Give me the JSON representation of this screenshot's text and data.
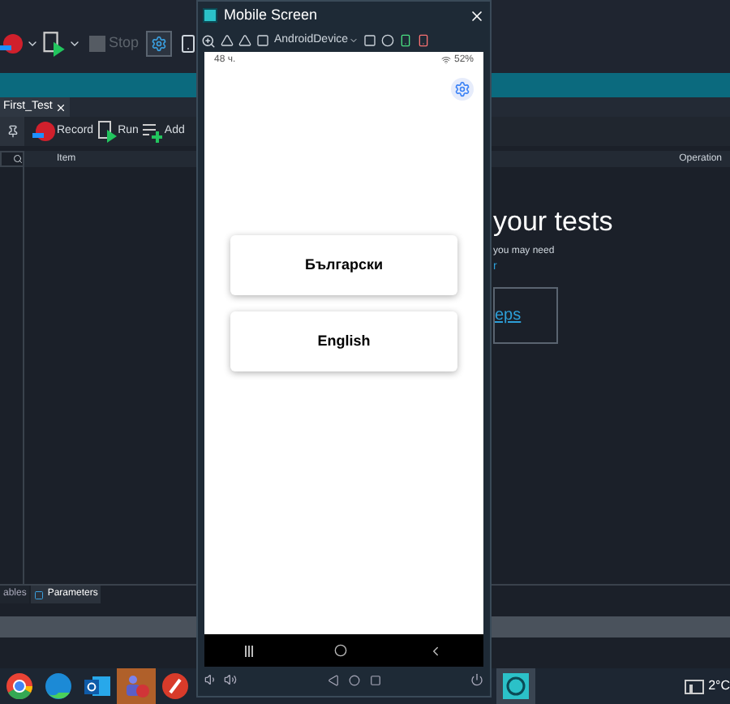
{
  "ide": {
    "toolbar": {
      "stop": {
        "label": "Stop",
        "disabled": true
      }
    },
    "tab": {
      "label": "First_Test",
      "selected": true
    },
    "actions": [
      {
        "kind": "record",
        "label": "Record"
      },
      {
        "kind": "run",
        "label": "Run"
      },
      {
        "kind": "add",
        "label": "Add"
      }
    ],
    "columns": [
      "Item",
      "Operation"
    ],
    "welcome": {
      "heading": "your tests",
      "text": "you may need",
      "link": "r",
      "card_link": "eps"
    },
    "bottom_tabs": [
      {
        "label": "ables",
        "selected": false
      },
      {
        "label": "Parameters",
        "selected": true
      }
    ]
  },
  "mobile_window": {
    "title": "Mobile Screen",
    "device": "AndroidDevice",
    "status_time": "48 ч.",
    "battery": "52%",
    "language_buttons": [
      "Български",
      "English"
    ]
  },
  "taskbar": {
    "apps": [
      {
        "kind": "chrome",
        "selected": false
      },
      {
        "kind": "edge",
        "selected": false
      },
      {
        "kind": "outlook",
        "selected": false
      },
      {
        "kind": "teams",
        "selected": true
      },
      {
        "kind": "red",
        "selected": false
      },
      {
        "kind": "mobile",
        "selected": true
      }
    ],
    "temperature": "2°C"
  }
}
